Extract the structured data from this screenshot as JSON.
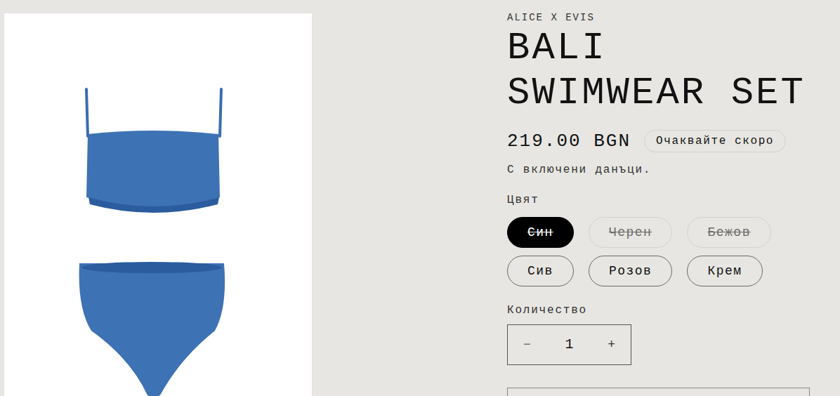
{
  "product": {
    "brand": "ALICE X EVIS",
    "title_lines": [
      "BALI",
      "SWIMWEAR SET"
    ],
    "price": "219.00 BGN",
    "badge": "Очаквайте скоро",
    "tax_note": "С включени данъци."
  },
  "color_picker": {
    "label": "Цвят",
    "options": [
      {
        "name": "Син",
        "selected": true,
        "available": false
      },
      {
        "name": "Черен",
        "selected": false,
        "available": false
      },
      {
        "name": "Бежов",
        "selected": false,
        "available": false
      },
      {
        "name": "Сив",
        "selected": false,
        "available": true
      },
      {
        "name": "Розов",
        "selected": false,
        "available": true
      },
      {
        "name": "Крем",
        "selected": false,
        "available": true
      }
    ]
  },
  "quantity": {
    "label": "Количество",
    "value": "1",
    "decrement": "−",
    "increment": "+"
  }
}
